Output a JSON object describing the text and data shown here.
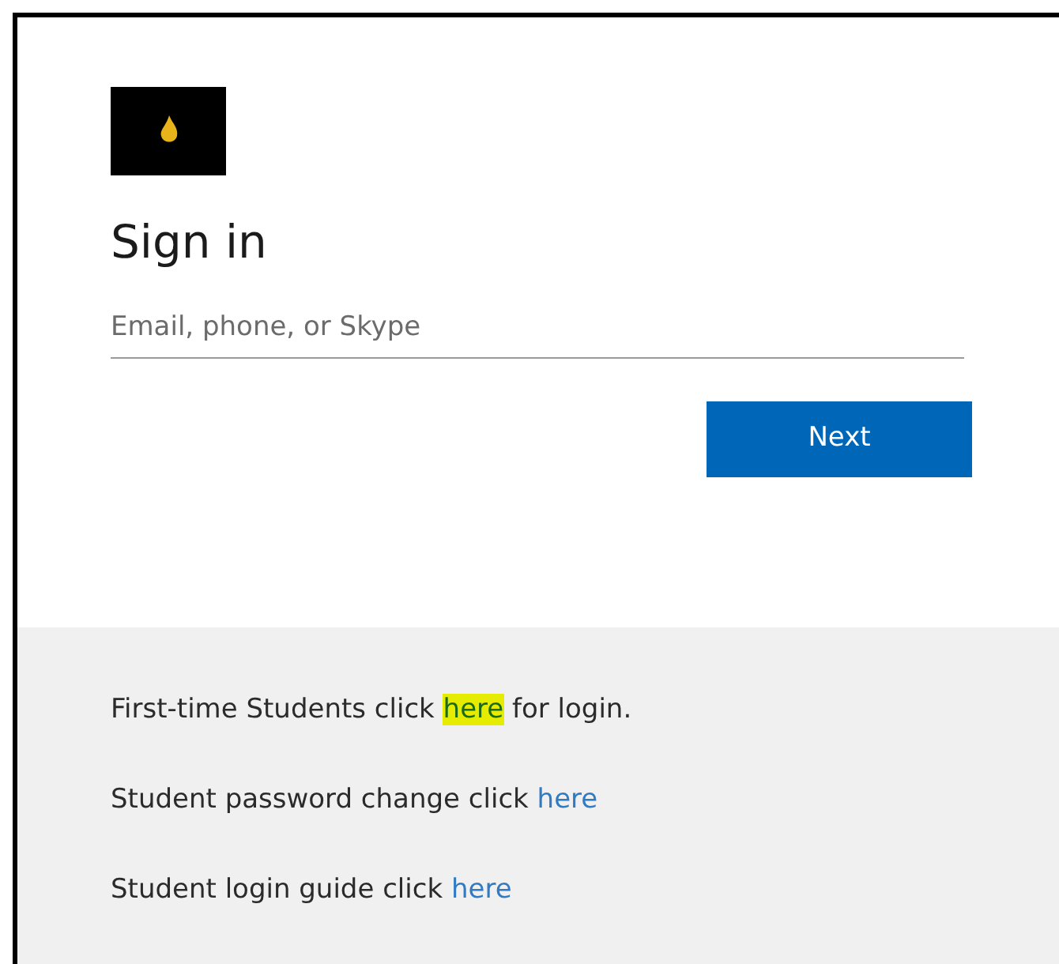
{
  "title": "Sign in",
  "email": {
    "placeholder": "Email, phone, or Skype"
  },
  "next_button": "Next",
  "links": [
    {
      "text": "First-time Students click ",
      "link": "here",
      "after": " for login.",
      "highlighted": true
    },
    {
      "text": "Student password change click ",
      "link": "here",
      "highlighted": false
    },
    {
      "text": "Student login guide click ",
      "link": "here",
      "highlighted": false
    }
  ]
}
